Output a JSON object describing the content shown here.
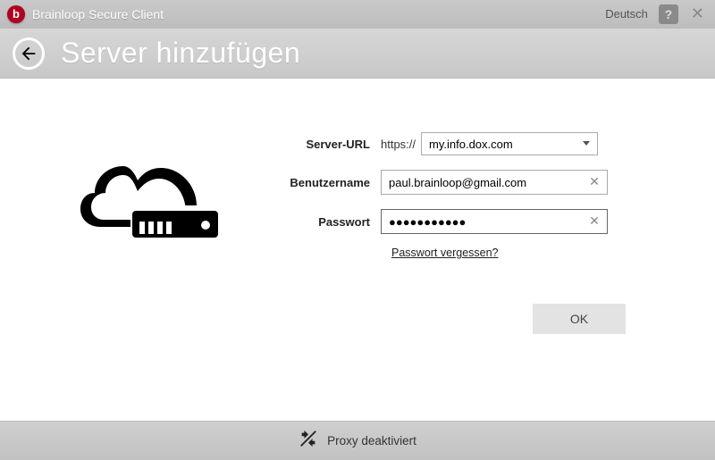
{
  "titlebar": {
    "app_name": "Brainloop Secure Client",
    "language": "Deutsch"
  },
  "header": {
    "page_title": "Server hinzufügen"
  },
  "form": {
    "server_url_label": "Server-URL",
    "protocol": "https://",
    "server_url_value": "my.info.dox.com",
    "username_label": "Benutzername",
    "username_value": "paul.brainloop@gmail.com",
    "password_label": "Passwort",
    "password_value": "●●●●●●●●●●●",
    "forgot_password": "Passwort vergessen?",
    "ok_label": "OK"
  },
  "statusbar": {
    "proxy_text": "Proxy deaktiviert"
  }
}
